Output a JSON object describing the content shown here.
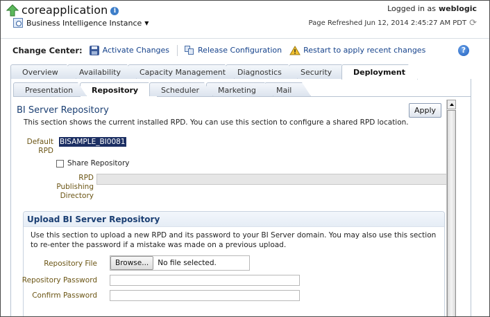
{
  "header": {
    "app_title": "coreapplication",
    "target_type": "Business Intelligence Instance",
    "logged_in_label": "Logged in as",
    "username": "weblogic",
    "page_refreshed": "Page Refreshed Jun 12, 2014 2:45:27 AM PDT"
  },
  "change_center": {
    "label": "Change Center:",
    "activate_changes": "Activate Changes",
    "release_configuration": "Release Configuration",
    "restart_message": "Restart to apply recent changes"
  },
  "main_tabs": [
    {
      "label": "Overview"
    },
    {
      "label": "Availability"
    },
    {
      "label": "Capacity Management"
    },
    {
      "label": "Diagnostics"
    },
    {
      "label": "Security"
    },
    {
      "label": "Deployment"
    }
  ],
  "sub_tabs": [
    {
      "label": "Presentation"
    },
    {
      "label": "Repository"
    },
    {
      "label": "Scheduler"
    },
    {
      "label": "Marketing"
    },
    {
      "label": "Mail"
    }
  ],
  "repository": {
    "title": "BI Server Repository",
    "description": "This section shows the current installed RPD. You can use this section to configure a shared RPD location.",
    "apply_label": "Apply",
    "default_rpd_label": "Default RPD",
    "default_rpd_value": "BISAMPLE_BI0081",
    "share_repository_label": "Share Repository",
    "share_repository_checked": false,
    "publishing_dir_label": "RPD Publishing Directory",
    "publishing_dir_value": ""
  },
  "upload": {
    "title": "Upload BI Server Repository",
    "description": "Use this section to upload a new RPD and its password to your BI Server domain. You may also use this section to re-enter the password if a mistake was made on a previous upload.",
    "file_label": "Repository File",
    "browse_label": "Browse...",
    "file_status": "No file selected.",
    "password_label": "Repository Password",
    "confirm_label": "Confirm Password"
  },
  "colors": {
    "link": "#15428b",
    "section_title": "#1b3f73",
    "form_label": "#6b5514",
    "selection_bg": "#1c2f63"
  }
}
